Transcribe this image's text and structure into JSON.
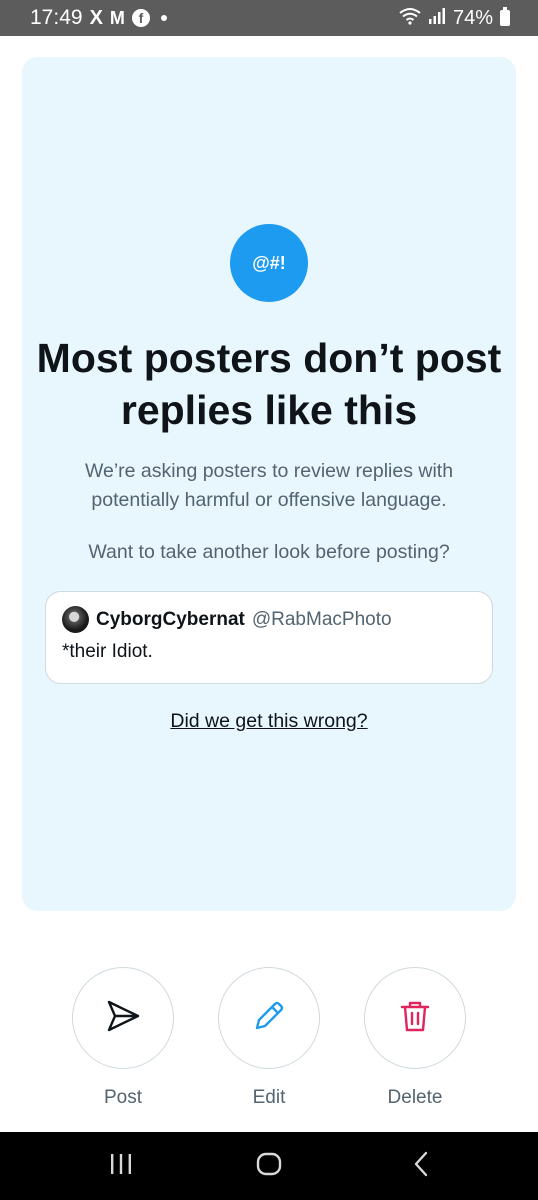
{
  "status_bar": {
    "time": "17:49",
    "app_icons": [
      "x-icon",
      "gmail-icon",
      "facebook-icon",
      "notification-dot"
    ],
    "x_glyph": "X",
    "gmail_glyph": "M",
    "facebook_glyph": "f",
    "battery": "74%"
  },
  "prompt": {
    "badge": "@#!",
    "headline": "Most posters don’t post replies like this",
    "subtext": "We’re asking posters to review replies with potentially harmful or offensive language.",
    "question": "Want to take another look before posting?",
    "reply": {
      "name": "CyborgCybernat",
      "handle": "@RabMacPhoto",
      "text": "*their Idiot."
    },
    "feedback_link": "Did we get this wrong?"
  },
  "actions": {
    "post_label": "Post",
    "edit_label": "Edit",
    "delete_label": "Delete"
  },
  "colors": {
    "card_background": "#e8f6fe",
    "accent_blue": "#1d9bf0",
    "delete_red": "#f4212e",
    "secondary_text": "#536471"
  }
}
